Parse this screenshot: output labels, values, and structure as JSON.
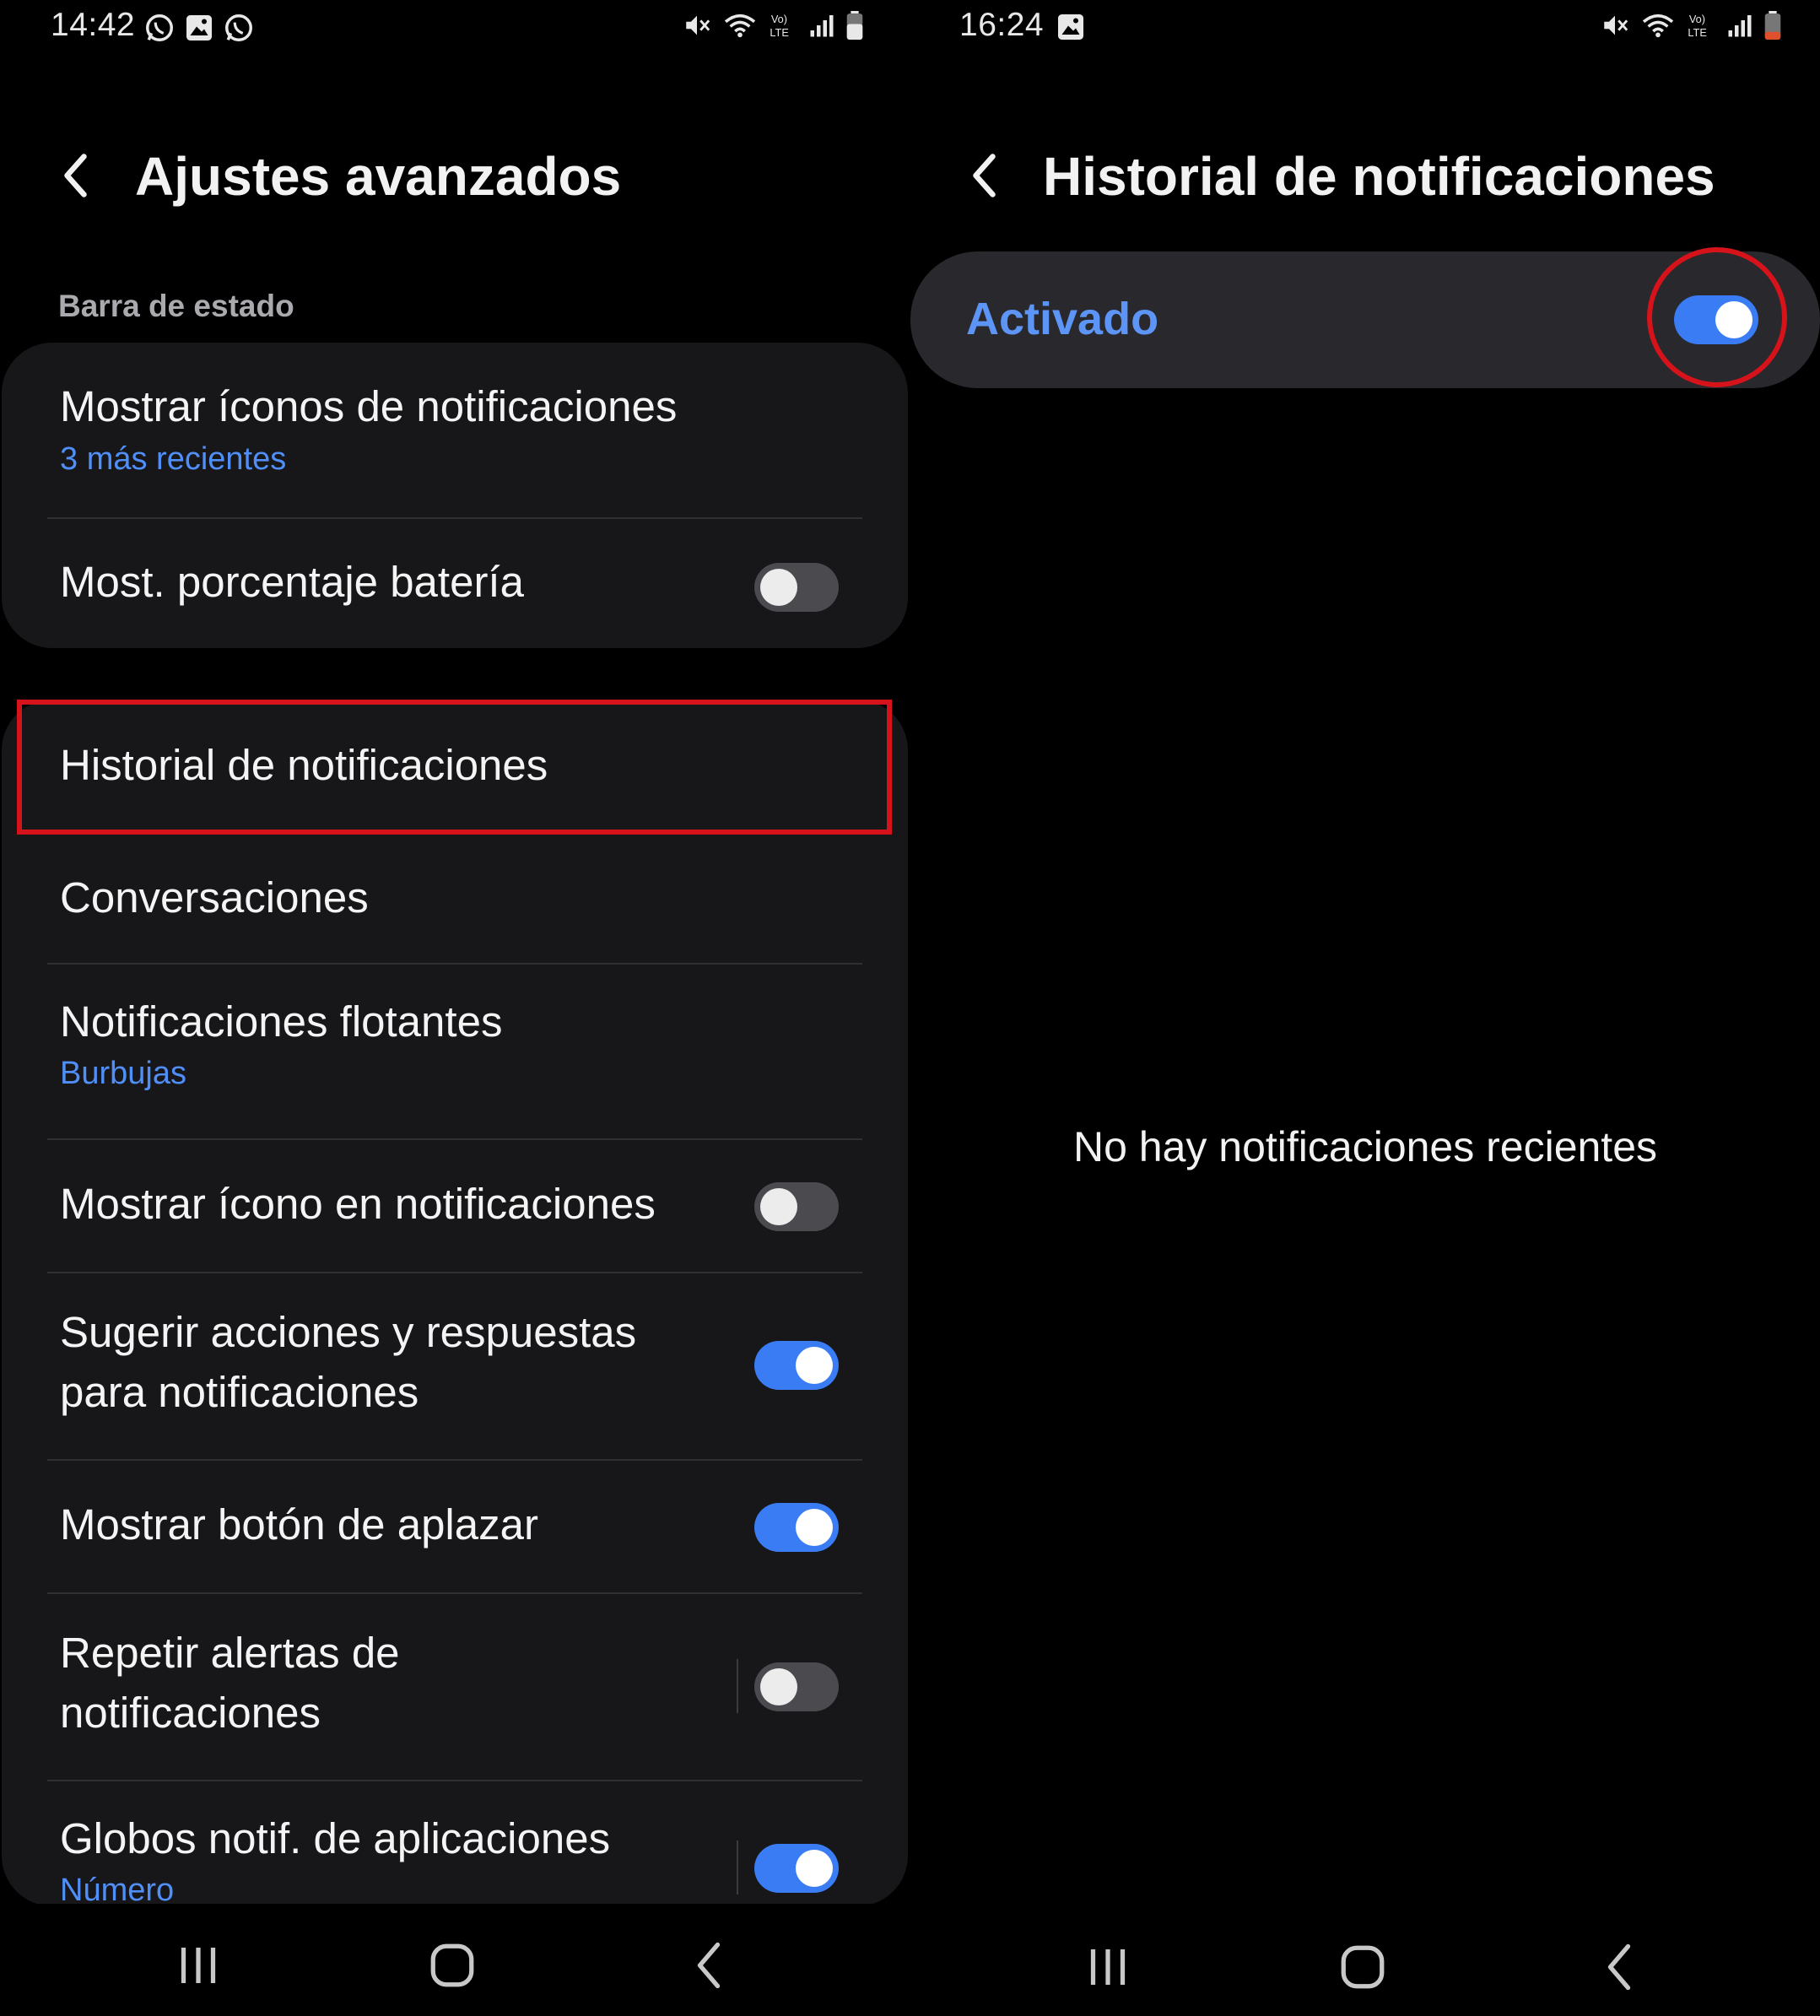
{
  "left": {
    "status": {
      "time": "14:42"
    },
    "header": {
      "title": "Ajustes avanzados"
    },
    "section_label": "Barra de estado",
    "items": [
      {
        "title": "Mostrar íconos de notificaciones",
        "subtitle": "3 más recientes"
      },
      {
        "title": "Most. porcentaje batería",
        "toggle": "off"
      },
      {
        "title": "Historial de notificaciones"
      },
      {
        "title": "Conversaciones"
      },
      {
        "title": "Notificaciones flotantes",
        "subtitle": "Burbujas"
      },
      {
        "title": "Mostrar ícono en notificaciones",
        "toggle": "off"
      },
      {
        "title_line1": "Sugerir acciones y respuestas",
        "title_line2": "para notificaciones",
        "toggle": "on"
      },
      {
        "title": "Mostrar botón de aplazar",
        "toggle": "on"
      },
      {
        "title_line1": "Repetir alertas de",
        "title_line2": "notificaciones",
        "toggle": "off"
      },
      {
        "title": "Globos notif. de aplicaciones",
        "subtitle": "Número",
        "toggle": "on"
      }
    ]
  },
  "right": {
    "status": {
      "time": "16:24"
    },
    "header": {
      "title": "Historial de notificaciones"
    },
    "master_switch": {
      "label": "Activado",
      "toggle": "on"
    },
    "empty_message": "No hay notificaciones recientes"
  },
  "colors": {
    "accent_blue": "#3a7cf4",
    "subtitle_blue": "#4f8ff7",
    "highlight_red": "#d6131b",
    "card_bg": "#17171a"
  },
  "icons": [
    "whatsapp-icon",
    "gallery-icon",
    "mute-icon",
    "wifi-icon",
    "volte-icon",
    "signal-icon",
    "battery-icon",
    "back-arrow-icon",
    "recents-icon",
    "home-icon",
    "back-nav-icon"
  ]
}
